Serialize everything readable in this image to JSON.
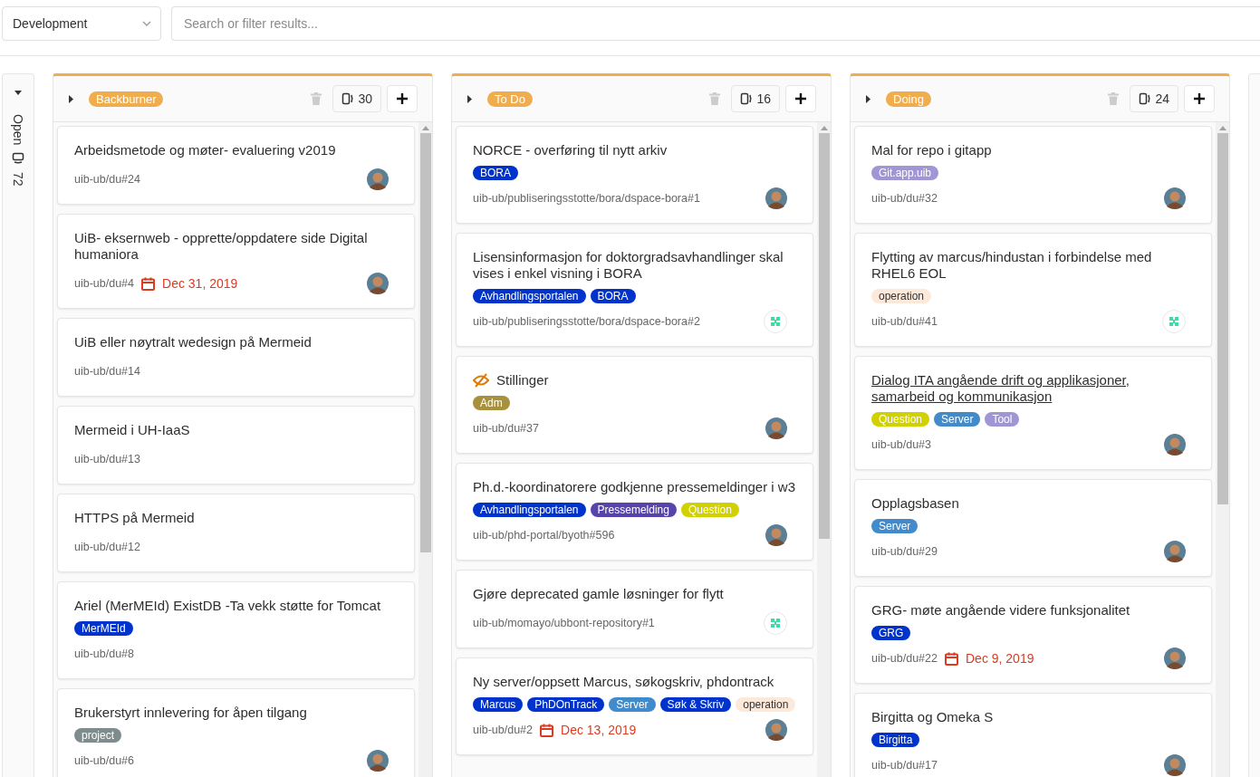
{
  "filter": {
    "board": "Development",
    "search_placeholder": "Search or filter results..."
  },
  "collapsed_list": {
    "title": "Open",
    "count": "72",
    "expanded": false
  },
  "lists": [
    {
      "title": "Backburner",
      "color": "#f0ad4e",
      "count": "30",
      "expanded": false,
      "cards": [
        {
          "title": "Arbeidsmetode og møter- evaluering v2019",
          "ref": "uib-ub/du#24",
          "avatar": {
            "kind": "person"
          }
        },
        {
          "title": "UiB- eksernweb - opprette/oppdatere side Digital humaniora",
          "ref": "uib-ub/du#4",
          "due": "Dec 31, 2019",
          "avatar": {
            "kind": "person"
          }
        },
        {
          "title": "UiB eller nøytralt wedesign på Mermeid",
          "ref": "uib-ub/du#14"
        },
        {
          "title": "Mermeid i UH-IaaS",
          "ref": "uib-ub/du#13"
        },
        {
          "title": "HTTPS på Mermeid",
          "ref": "uib-ub/du#12"
        },
        {
          "title": "Ariel (MerMEId) ExistDB -Ta vekk støtte for Tomcat",
          "labels": [
            {
              "text": "MerMEId",
              "color": "#0033cc"
            }
          ],
          "ref": "uib-ub/du#8"
        },
        {
          "title": "Brukerstyrt innlevering for åpen tilgang",
          "labels": [
            {
              "text": "project",
              "color": "#7f8c8d"
            }
          ],
          "ref": "uib-ub/du#6",
          "avatar": {
            "kind": "person"
          }
        }
      ]
    },
    {
      "title": "To Do",
      "color": "#f0ad4e",
      "count": "16",
      "expanded": false,
      "cards": [
        {
          "title": "NORCE - overføring til nytt arkiv",
          "labels": [
            {
              "text": "BORA",
              "color": "#0033cc"
            }
          ],
          "ref": "uib-ub/publiseringsstotte/bora/dspace-bora#1",
          "avatar": {
            "kind": "person"
          }
        },
        {
          "title": "Lisensinformasjon for doktorgradsavhandlinger skal vises i enkel visning i BORA",
          "labels": [
            {
              "text": "Avhandlingsportalen",
              "color": "#0033cc"
            },
            {
              "text": "BORA",
              "color": "#0033cc"
            }
          ],
          "ref": "uib-ub/publiseringsstotte/bora/dspace-bora#2",
          "avatar": {
            "kind": "identicon"
          }
        },
        {
          "title": "Stillinger",
          "confidential": true,
          "labels": [
            {
              "text": "Adm",
              "color": "#a8913d"
            }
          ],
          "ref": "uib-ub/du#37",
          "avatar": {
            "kind": "person"
          }
        },
        {
          "title": "Ph.d.-koordinatorere godkjenne pressemeldinger i w3",
          "labels": [
            {
              "text": "Avhandlingsportalen",
              "color": "#0033cc"
            },
            {
              "text": "Pressemelding",
              "color": "#5843ad"
            },
            {
              "text": "Question",
              "color": "#d1d100"
            }
          ],
          "ref": "uib-ub/phd-portal/byoth#596",
          "avatar": {
            "kind": "person"
          }
        },
        {
          "title": "Gjøre deprecated gamle løsninger for flytt",
          "ref": "uib-ub/momayo/ubbont-repository#1",
          "avatar": {
            "kind": "identicon"
          }
        },
        {
          "title": "Ny server/oppsett Marcus, søkogskriv, phdontrack",
          "labels": [
            {
              "text": "Marcus",
              "color": "#0033cc"
            },
            {
              "text": "PhDOnTrack",
              "color": "#0033cc"
            },
            {
              "text": "Server",
              "color": "#428bca"
            },
            {
              "text": "Søk & Skriv",
              "color": "#0033cc"
            },
            {
              "text": "operation",
              "color": "#fde9da"
            }
          ],
          "ref": "uib-ub/du#2",
          "due": "Dec 13, 2019",
          "avatar": {
            "kind": "person"
          }
        }
      ]
    },
    {
      "title": "Doing",
      "color": "#f0ad4e",
      "count": "24",
      "expanded": false,
      "cards": [
        {
          "title": "Mal for repo i gitapp",
          "labels": [
            {
              "text": "Git.app.uib",
              "color": "#a295d6"
            }
          ],
          "ref": "uib-ub/du#32",
          "avatar": {
            "kind": "person"
          }
        },
        {
          "title": "Flytting av marcus/hindustan i forbindelse med RHEL6 EOL",
          "labels": [
            {
              "text": "operation",
              "color": "#fde9da"
            }
          ],
          "ref": "uib-ub/du#41",
          "avatar": {
            "kind": "identicon"
          }
        },
        {
          "title": "Dialog ITA angående drift og applikasjoner, samarbeid og kommunikasjon",
          "hovered": true,
          "labels": [
            {
              "text": "Question",
              "color": "#d1d100"
            },
            {
              "text": "Server",
              "color": "#428bca"
            },
            {
              "text": "Tool",
              "color": "#a295d6"
            }
          ],
          "ref": "uib-ub/du#3",
          "avatar": {
            "kind": "person"
          }
        },
        {
          "title": "Opplagsbasen",
          "labels": [
            {
              "text": "Server",
              "color": "#428bca"
            }
          ],
          "ref": "uib-ub/du#29",
          "avatar": {
            "kind": "person"
          }
        },
        {
          "title": "GRG- møte angående videre funksjonalitet",
          "labels": [
            {
              "text": "GRG",
              "color": "#0033cc"
            }
          ],
          "ref": "uib-ub/du#22",
          "due": "Dec 9, 2019",
          "avatar": {
            "kind": "person"
          }
        },
        {
          "title": "Birgitta og Omeka S",
          "labels": [
            {
              "text": "Birgitta",
              "color": "#0033cc"
            }
          ],
          "ref": "uib-ub/du#17",
          "avatar": {
            "kind": "person"
          }
        }
      ]
    }
  ]
}
